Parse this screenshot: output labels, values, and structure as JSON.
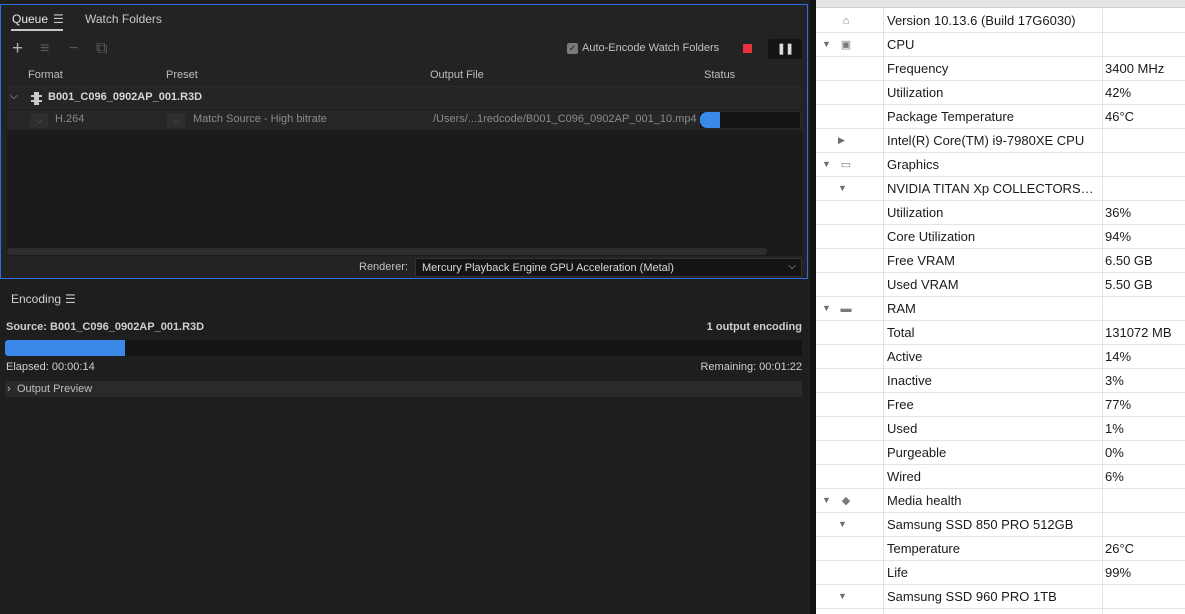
{
  "queue": {
    "tabs": {
      "queue": "Queue",
      "watch_folders": "Watch Folders"
    },
    "toolbar": {
      "add_icon": "+",
      "settings_icon": "≡",
      "remove_icon": "−",
      "duplicate_icon": "⧉",
      "auto_encode_label": "Auto-Encode Watch Folders",
      "auto_encode_checked": true,
      "pause_glyph": "❚❚"
    },
    "columns": {
      "format": "Format",
      "preset": "Preset",
      "output_file": "Output File",
      "status": "Status"
    },
    "source": {
      "name": "B001_C096_0902AP_001.R3D"
    },
    "output": {
      "format": "H.264",
      "preset": "Match Source - High bitrate",
      "file": "/Users/...1redcode/B001_C096_0902AP_001_10.mp4",
      "progress": 0.2
    },
    "renderer": {
      "label": "Renderer:",
      "value": "Mercury Playback Engine GPU Acceleration (Metal)"
    }
  },
  "encoding": {
    "title": "Encoding",
    "source": "Source: B001_C096_0902AP_001.R3D",
    "count": "1 output encoding",
    "progress": 0.15,
    "elapsed": "Elapsed: 00:00:14",
    "remaining": "Remaining: 00:01:22",
    "output_preview": "Output Preview"
  },
  "monitor": {
    "rows": [
      {
        "level": 0,
        "triangle": "",
        "icon": "os-icon",
        "label": "Version 10.13.6 (Build 17G6030)",
        "value": ""
      },
      {
        "level": 0,
        "triangle": "down",
        "icon": "cpu-icon",
        "label": "CPU",
        "value": ""
      },
      {
        "level": 1,
        "triangle": "",
        "icon": "",
        "label": "Frequency",
        "value": "3400 MHz"
      },
      {
        "level": 1,
        "triangle": "",
        "icon": "",
        "label": "Utilization",
        "value": "42%"
      },
      {
        "level": 1,
        "triangle": "",
        "icon": "",
        "label": "Package Temperature",
        "value": "46°C"
      },
      {
        "level": 1,
        "triangle": "right",
        "icon": "",
        "label": "Intel(R) Core(TM) i9-7980XE CPU",
        "value": ""
      },
      {
        "level": 0,
        "triangle": "down",
        "icon": "gpu-icon",
        "label": "Graphics",
        "value": ""
      },
      {
        "level": 1,
        "triangle": "down",
        "icon": "",
        "label": "NVIDIA TITAN Xp COLLECTORS…",
        "value": ""
      },
      {
        "level": 2,
        "triangle": "",
        "icon": "",
        "label": "Utilization",
        "value": "36%"
      },
      {
        "level": 2,
        "triangle": "",
        "icon": "",
        "label": "Core Utilization",
        "value": "94%"
      },
      {
        "level": 2,
        "triangle": "",
        "icon": "",
        "label": "Free VRAM",
        "value": "6.50 GB"
      },
      {
        "level": 2,
        "triangle": "",
        "icon": "",
        "label": "Used VRAM",
        "value": "5.50 GB"
      },
      {
        "level": 0,
        "triangle": "down",
        "icon": "ram-icon",
        "label": "RAM",
        "value": ""
      },
      {
        "level": 1,
        "triangle": "",
        "icon": "",
        "label": "Total",
        "value": "131072 MB"
      },
      {
        "level": 1,
        "triangle": "",
        "icon": "",
        "label": "Active",
        "value": "14%"
      },
      {
        "level": 1,
        "triangle": "",
        "icon": "",
        "label": "Inactive",
        "value": "3%"
      },
      {
        "level": 1,
        "triangle": "",
        "icon": "",
        "label": "Free",
        "value": "77%"
      },
      {
        "level": 1,
        "triangle": "",
        "icon": "",
        "label": "Used",
        "value": "1%"
      },
      {
        "level": 1,
        "triangle": "",
        "icon": "",
        "label": "Purgeable",
        "value": "0%"
      },
      {
        "level": 1,
        "triangle": "",
        "icon": "",
        "label": "Wired",
        "value": "6%"
      },
      {
        "level": 0,
        "triangle": "down",
        "icon": "disk-icon",
        "label": "Media health",
        "value": ""
      },
      {
        "level": 1,
        "triangle": "down",
        "icon": "",
        "label": "Samsung SSD 850 PRO 512GB",
        "value": ""
      },
      {
        "level": 2,
        "triangle": "",
        "icon": "",
        "label": "Temperature",
        "value": "26°C"
      },
      {
        "level": 2,
        "triangle": "",
        "icon": "",
        "label": "Life",
        "value": "99%"
      },
      {
        "level": 1,
        "triangle": "down",
        "icon": "",
        "label": "Samsung SSD 960 PRO 1TB",
        "value": ""
      }
    ]
  },
  "colors": {
    "accent": "#2d6ee0",
    "progress": "#3a88e8",
    "stop": "#e8313d"
  }
}
